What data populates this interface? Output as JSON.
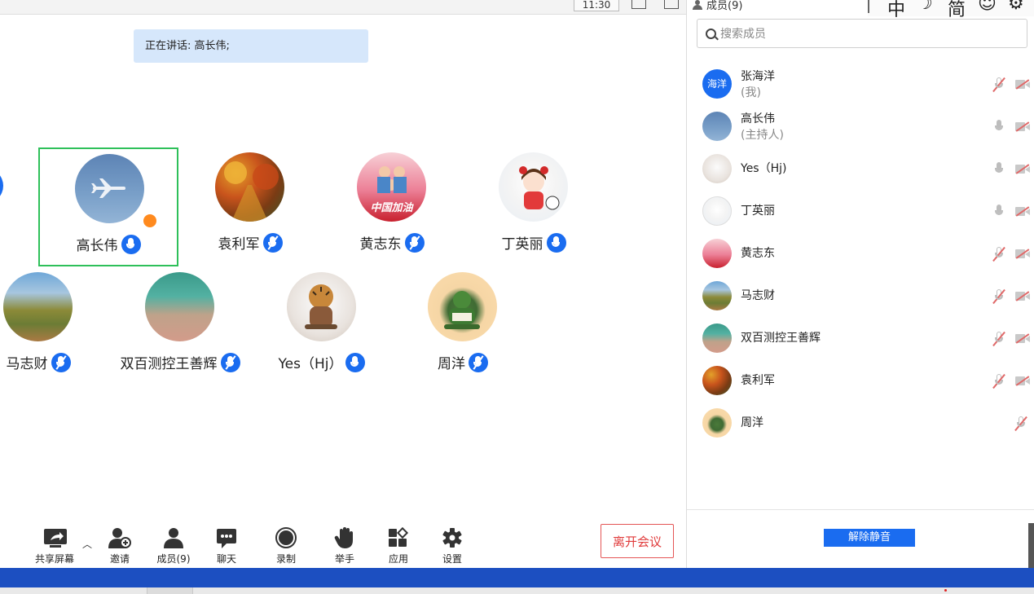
{
  "topbar": {
    "time": "11:30"
  },
  "speaking": {
    "text": "正在讲话: 高长伟;"
  },
  "participants": [
    {
      "name": "高长伟",
      "avatar": "plane",
      "mic": "on",
      "host": true,
      "active": true
    },
    {
      "name": "袁利军",
      "avatar": "autumn",
      "mic": "muted"
    },
    {
      "name": "黄志东",
      "avatar": "family",
      "mic": "muted",
      "avatar_text": "中国加油"
    },
    {
      "name": "丁英丽",
      "avatar": "girl",
      "mic": "on"
    },
    {
      "name": "马志财",
      "avatar": "mountain",
      "mic": "muted"
    },
    {
      "name": "双百测控王善辉",
      "avatar": "beach",
      "mic": "muted"
    },
    {
      "name": "Yes（Hj）",
      "avatar": "tiger",
      "mic": "on"
    },
    {
      "name": "周洋",
      "avatar": "hulk",
      "mic": "muted"
    }
  ],
  "toolbar": {
    "share": "共享屏幕",
    "invite": "邀请",
    "members": "成员(9)",
    "chat": "聊天",
    "record": "录制",
    "raise_hand": "举手",
    "apps": "应用",
    "settings": "设置",
    "leave": "离开会议"
  },
  "panel": {
    "title": "成员(9)",
    "sys_icons": [
      "中",
      "简"
    ],
    "search_placeholder": "搜索成员",
    "members": [
      {
        "name": "张海洋",
        "role": "(我)",
        "avatar": "blue",
        "avatar_text": "海洋",
        "mic": "muted",
        "cam": "off"
      },
      {
        "name": "高长伟",
        "role": "(主持人)",
        "avatar": "plane",
        "mic": "on",
        "cam": "off"
      },
      {
        "name": "Yes（Hj)",
        "avatar": "tiger",
        "mic": "on",
        "cam": "off"
      },
      {
        "name": "丁英丽",
        "avatar": "girl",
        "mic": "on",
        "cam": "off"
      },
      {
        "name": "黄志东",
        "avatar": "family",
        "mic": "muted",
        "cam": "off"
      },
      {
        "name": "马志财",
        "avatar": "mountain",
        "mic": "muted",
        "cam": "off"
      },
      {
        "name": "双百测控王善辉",
        "avatar": "beach",
        "mic": "muted",
        "cam": "off"
      },
      {
        "name": "袁利军",
        "avatar": "autumn",
        "mic": "muted",
        "cam": "off"
      },
      {
        "name": "周洋",
        "avatar": "hulk",
        "mic": "muted",
        "cam": "none"
      }
    ],
    "unmute_all": "解除静音"
  },
  "colors": {
    "accent": "#1a6cf0",
    "active_border": "#2ec05a",
    "leave": "#e03a3a",
    "taskbar": "#1c4fc1"
  }
}
